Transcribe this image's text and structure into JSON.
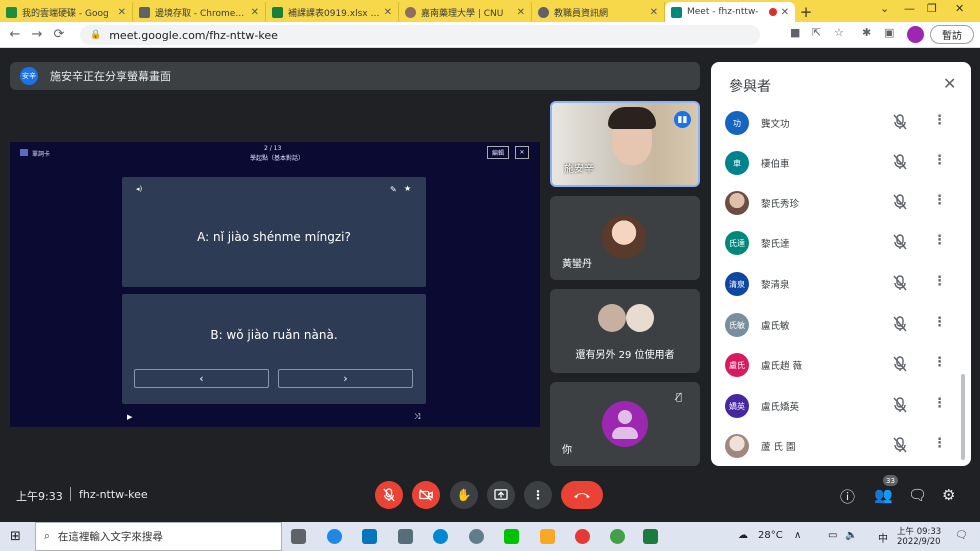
{
  "browser": {
    "tabs": [
      {
        "title": "我的雲端硬碟 - Goog",
        "color": "#1e8e3e"
      },
      {
        "title": "邊境存取 - Chrome 主",
        "color": "#5f6368"
      },
      {
        "title": "補課課表0919.xlsx - G",
        "color": "#188038"
      },
      {
        "title": "嘉南藥理大學 | CNU",
        "color": "#8d6e63"
      },
      {
        "title": "教職員資訊網",
        "color": "#5f6368"
      },
      {
        "title": "Meet - fhz-nttw-",
        "color": "#00897b"
      }
    ],
    "url": "meet.google.com/fhz-nttw-kee",
    "paused_label": "暫訪"
  },
  "meet": {
    "presenting_text": "施安辛正在分享螢幕畫面",
    "presenter_badge": "安辛",
    "shared": {
      "deck_label": "單詞卡",
      "page": "2 / 13",
      "subtitle": "學起點（基本對話）",
      "edit_label": "編輯",
      "line_a": "A: nǐ jiào shénme míngzi?",
      "line_b": "B: wǒ jiào ruǎn nànà.",
      "prev": "‹",
      "next": "›"
    },
    "tiles": [
      {
        "name": "施安辛"
      },
      {
        "name": "黃蠻丹"
      },
      {
        "name": "還有另外 29 位使用者"
      },
      {
        "name": "你"
      }
    ],
    "meeting_time": "上午9:33",
    "meeting_code": "fhz-nttw-kee",
    "participant_count": "33"
  },
  "panel": {
    "title": "參與者",
    "participants": [
      {
        "initials": "功",
        "name": "龔文功",
        "color": "#1565c0"
      },
      {
        "initials": "車",
        "name": "棲伯車",
        "color": "#00838f"
      },
      {
        "initials": "",
        "name": "黎氏秀珍",
        "color": "#a1887f"
      },
      {
        "initials": "氏達",
        "name": "黎氏達",
        "color": "#00897b"
      },
      {
        "initials": "清泉",
        "name": "黎清泉",
        "color": "#0d47a1"
      },
      {
        "initials": "氏敏",
        "name": "盧氏敏",
        "color": "#78909c"
      },
      {
        "initials": "盧氏",
        "name": "盧氏趙 薇",
        "color": "#d81b60"
      },
      {
        "initials": "嬌英",
        "name": "盧氏嬌英",
        "color": "#4527a0"
      },
      {
        "initials": "",
        "name": "蘆 氏 園",
        "color": "#bcaaa4"
      }
    ]
  },
  "taskbar": {
    "search_placeholder": "在這裡輸入文字來搜尋",
    "weather": "28°C",
    "ime": "中",
    "clock_time": "上午 09:33",
    "clock_date": "2022/9/20"
  }
}
